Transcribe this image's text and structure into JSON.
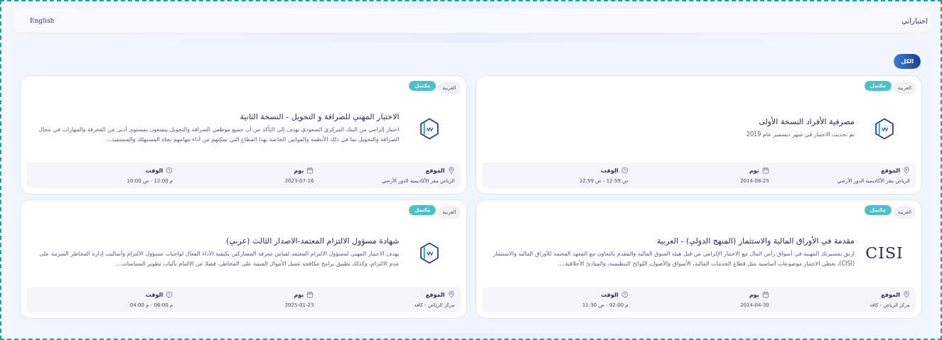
{
  "header": {
    "title": "اختباراتي",
    "language_link": "English"
  },
  "filters": [
    {
      "label": "الكل",
      "selected": true
    }
  ],
  "cards": [
    {
      "logo": {
        "kind": "hexagon"
      },
      "badges": {
        "language": "العربية",
        "status": "مكتمل"
      },
      "title": "مصرفية الأفراد النسخة الأولى",
      "description": "تم تحديث الاختبار في شهر ديسمبر عام 2019",
      "info": [
        {
          "kind": "location",
          "label": "الموقع",
          "value": "الرياض مقر الأكاديمية الدور الأرضي"
        },
        {
          "kind": "day",
          "label": "يوم",
          "value": "2014-08-25"
        },
        {
          "kind": "time",
          "label": "الوقت",
          "value": "12:59 ص - 12:59 ص"
        }
      ]
    },
    {
      "logo": {
        "kind": "hexagon"
      },
      "badges": {
        "language": "العربية",
        "status": "مكتمل"
      },
      "title": "الاختبار المهني للصرافة و التحويل - النسخة الثانية",
      "description": "اختبار إلزامي من البنك المركزي السعودي يهدف إلى التأكد من أن جميع موظفي الصرافة والتحويل يتمتعون بمستوى أدنى من المعرفة والمهارات في مجال الصرافة والتحويل بما في ذلك الأنظمة والقوانين الخاصة بهذا القطاع التي تمكنهم من أداء مهامهم تجاه المستهلك والمستفيد...",
      "info": [
        {
          "kind": "location",
          "label": "الموقع",
          "value": "الرياض مقر الأكاديمية الدور الأرضي"
        },
        {
          "kind": "day",
          "label": "يوم",
          "value": "2023-07-16"
        },
        {
          "kind": "time",
          "label": "الوقت",
          "value": "10:00 ص - 12:00 م"
        }
      ]
    },
    {
      "logo": {
        "kind": "text",
        "text": "CISI"
      },
      "badges": {
        "language": "العربية",
        "status": "مكتمل"
      },
      "title": "مقدمة في الأوراق المالية والاستثمار (المنهج الدولي) - العربية",
      "description": "ارتقِ بمسيرتك المهنية في أسواق رأس المال مع الاختبار الإلزامي من قبل هيئة السوق المالية والمقدم بالتعاون مع المعهد المعتمد للأوراق المالية والاستثمار (CISI)، يغطي الاختبار موضوعات أساسية مثل قطاع الخدمات المالية، الأسواق والأصول، اللوائح التنظيمية، والمبادئ الأخلاقية....",
      "info": [
        {
          "kind": "location",
          "label": "الموقع",
          "value": "مركز الرياض - كافد"
        },
        {
          "kind": "day",
          "label": "يوم",
          "value": "2024-04-30"
        },
        {
          "kind": "time",
          "label": "الوقت",
          "value": "11:30 ص - 02:00 م"
        }
      ]
    },
    {
      "logo": {
        "kind": "hexagon"
      },
      "badges": {
        "language": "العربية",
        "status": "مكتمل"
      },
      "title": "شهادة مسؤول الالتزام المعتمد-الاصدار الثالث (عربي)",
      "description": "يهدف الاختبار المهني لمسؤول الالتزام المعتمد لقياس معرفة المشاركين بكيفية الأداء الفعال لواجبات مسؤول الالتزام وأساليب إدارة المخاطر المترتبة على عدم الالتزام، وكذلك تطبيق برامج مكافحة غسل الأموال المبنية على المخاطر، فضلا عن الالمام بآليات تطوير السياسات...",
      "info": [
        {
          "kind": "location",
          "label": "الموقع",
          "value": "مركز الرياض - كافد"
        },
        {
          "kind": "day",
          "label": "يوم",
          "value": "2025-01-23"
        },
        {
          "kind": "time",
          "label": "الوقت",
          "value": "04:00 م - 06:00 م"
        }
      ]
    }
  ]
}
